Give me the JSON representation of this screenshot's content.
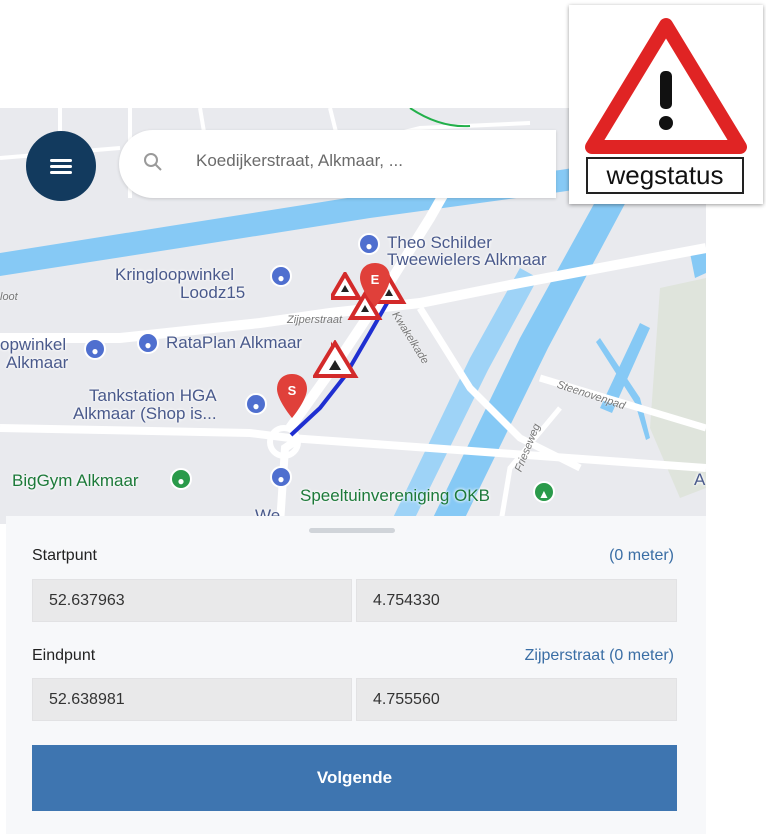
{
  "search": {
    "placeholder": "Koedijkerstraat, Alkmaar, ..."
  },
  "logo": {
    "text": "wegstatus"
  },
  "map": {
    "pois": [
      "Theo Schilder",
      "Tweewielers Alkmaar",
      "Kringloopwinkel",
      "Loodz15",
      "opwinkel",
      "Alkmaar",
      "RataPlan Alkmaar",
      "Tankstation HGA",
      "Alkmaar (Shop is...",
      "BigGym Alkmaar",
      "Speeltuinvereniging OKB",
      "We...",
      "A"
    ],
    "streets": [
      "Zijperstraat",
      "Kwakelkade",
      "Steenovenpad",
      "Frieseweg",
      "loot"
    ],
    "start_marker": "S",
    "end_marker": "E"
  },
  "route": {
    "start_label": "Startpunt",
    "start_distance": "(0 meter)",
    "start_lat": "52.637963",
    "start_lon": "4.754330",
    "end_label": "Eindpunt",
    "end_distance": "Zijperstraat (0 meter)",
    "end_lat": "52.638981",
    "end_lon": "4.755560"
  },
  "next_button": "Volgende",
  "colors": {
    "primary": "#3e75b0",
    "menu": "#123a5e",
    "route": "#1f2fd1",
    "marker": "#e0403a"
  }
}
